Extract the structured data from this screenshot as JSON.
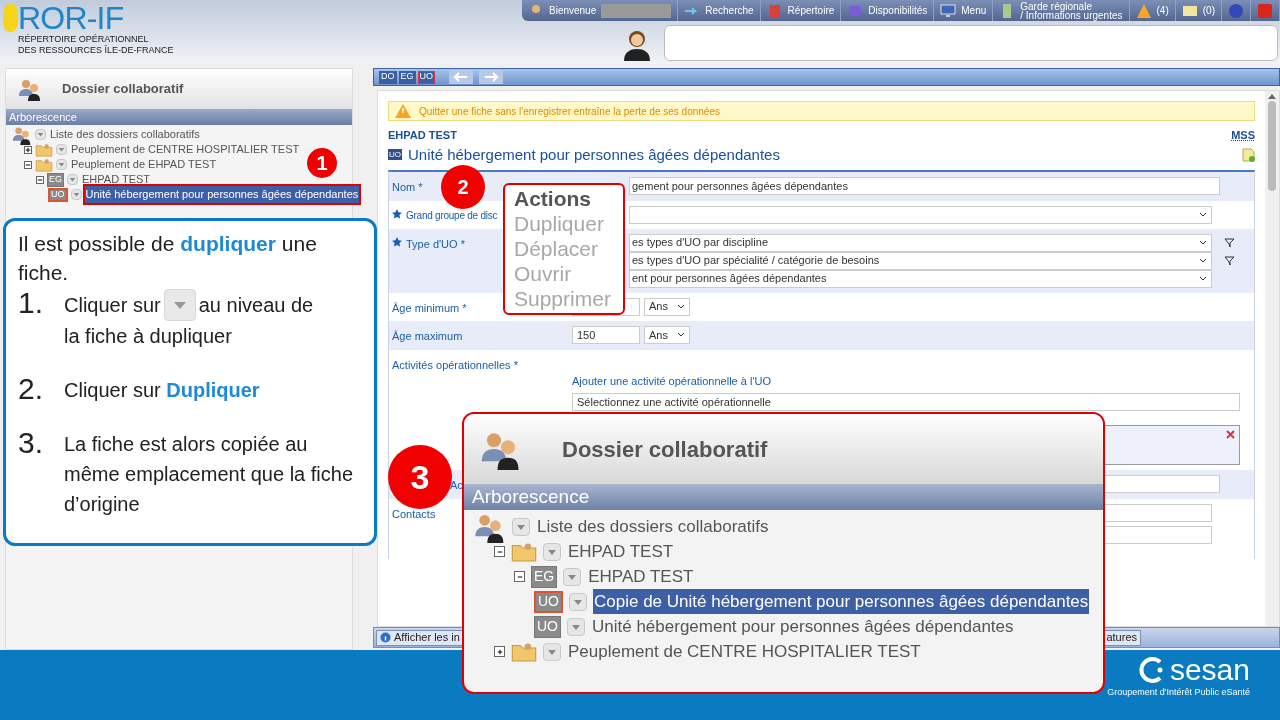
{
  "header": {
    "logo_title": "ROR-IF",
    "logo_line_1": "RÉPERTOIRE OPÉRATIONNEL",
    "logo_line_2": "DES RESSOURCES ÎLE-DE-FRANCE"
  },
  "nav": [
    {
      "kind": "user",
      "label": "Bienvenue"
    },
    {
      "kind": "search",
      "label": "Recherche"
    },
    {
      "kind": "book",
      "label": "Répertoire"
    },
    {
      "kind": "bed",
      "label": "Disponibilités"
    },
    {
      "kind": "monitor",
      "label": "Menu"
    },
    {
      "kind": "phone",
      "label": "Garde régionale",
      "label_2": "/ Informations urgentes"
    },
    {
      "kind": "alert",
      "label": "(4)"
    },
    {
      "kind": "mail",
      "label": "(0)"
    },
    {
      "kind": "help"
    },
    {
      "kind": "power"
    }
  ],
  "sidebar": {
    "title": "Dossier collaboratif",
    "section": "Arborescence",
    "tree": {
      "kind": "root",
      "label": "Liste des dossiers collaboratifs",
      "selected": false,
      "children": [
        {
          "kind": "folder",
          "label": "Peuplement de CENTRE HOSPITALIER TEST",
          "expanded": false,
          "selected": false
        },
        {
          "kind": "folder",
          "label": "Peuplement de EHPAD TEST",
          "expanded": true,
          "selected": false,
          "children": [
            {
              "kind": "badge",
              "badge": "EG",
              "label": "EHPAD TEST",
              "expanded": true,
              "selected": false,
              "children": [
                {
                  "kind": "badge",
                  "badge": "UO",
                  "label": "Unité hébergement pour personnes âgées dépendantes",
                  "selected": true
                }
              ]
            }
          ]
        }
      ]
    }
  },
  "toolbar": {
    "crumbs": [
      {
        "label": "DO",
        "selected": false
      },
      {
        "label": "EG",
        "selected": false
      },
      {
        "label": "UO",
        "selected": true
      }
    ]
  },
  "content": {
    "warning": "Quitter une fiche sans l'enregistrer entraîne la perte de ses données",
    "parent": "EHPAD TEST",
    "mss_link": "MSS",
    "badge": "UO",
    "title": "Unité hébergement pour personnes âgées dépendantes",
    "rows": [
      {
        "kind": "text",
        "label": "Nom *",
        "starred": false,
        "value": "gement pour personnes âgées dépendantes"
      },
      {
        "kind": "select",
        "label": "Grand groupe de disc",
        "starred": true
      },
      {
        "kind": "selects",
        "label": "Type d'UO *",
        "starred": true,
        "options": [
          {
            "value": "es types d'UO par discipline",
            "filter": true
          },
          {
            "value": "es types d'UO par spécialité / catégorie de besoins",
            "filter": true
          },
          {
            "value": "ent pour personnes âgées dépendantes",
            "filter": false
          }
        ]
      },
      {
        "kind": "age",
        "label": "Âge minimum *",
        "starred": false,
        "unit": "Ans"
      },
      {
        "kind": "age",
        "label": "Âge maximum",
        "starred": false,
        "value": "150",
        "unit": "Ans"
      },
      {
        "kind": "activities",
        "label": "Activités opérationnelles *",
        "starred": false,
        "link": "Ajouter une activité opérationnelle à l'UO",
        "placeholder": "Sélectionnez une activité opérationnelle"
      },
      {
        "kind": "text",
        "label": "Ac",
        "starred": false
      },
      {
        "kind": "contacts",
        "label": "Contacts",
        "starred": false
      }
    ]
  },
  "bottom_bar": {
    "buttons": [
      "Afficher les in",
      "atures"
    ]
  },
  "callout": {
    "intro": "Il est possible de **dupliquer** une fiche.",
    "steps": [
      {
        "number": "1.",
        "text": "Cliquer sur",
        "text_after": "au niveau de",
        "text_line_2": "la fiche à dupliquer"
      },
      {
        "number": "2.",
        "text": "Cliquer sur **Dupliquer**"
      },
      {
        "number": "3.",
        "text": "La fiche est alors copiée au même emplacement que la fiche d’origine"
      }
    ]
  },
  "markers": [
    "1",
    "2",
    "3"
  ],
  "actions_menu": {
    "title": "Actions",
    "items": [
      "Dupliquer",
      "Déplacer",
      "Ouvrir",
      "Supprimer"
    ]
  },
  "result": {
    "title": "Dossier collaboratif",
    "section": "Arborescence",
    "tree": {
      "kind": "root",
      "label": "Liste des dossiers collaboratifs",
      "selected": false,
      "children": [
        {
          "kind": "folder",
          "label": "EHPAD TEST",
          "expanded": true,
          "selected": false,
          "children": [
            {
              "kind": "badge",
              "badge": "EG",
              "label": "EHPAD TEST",
              "expanded": true,
              "selected": false,
              "children": [
                {
                  "kind": "badge",
                  "badge": "UO",
                  "label": "Copie de Unité hébergement pour personnes âgées dépendantes",
                  "selected": true
                },
                {
                  "kind": "badge",
                  "badge": "UO",
                  "label": "Unité hébergement pour personnes âgées dépendantes",
                  "selected": false
                }
              ]
            }
          ]
        },
        {
          "kind": "folder",
          "label": "Peuplement de CENTRE HOSPITALIER TEST",
          "expanded": false,
          "selected": false
        }
      ]
    }
  },
  "footer": {
    "logo": "sesan",
    "tagline": "Groupement d'Intérêt Public eSanté"
  }
}
